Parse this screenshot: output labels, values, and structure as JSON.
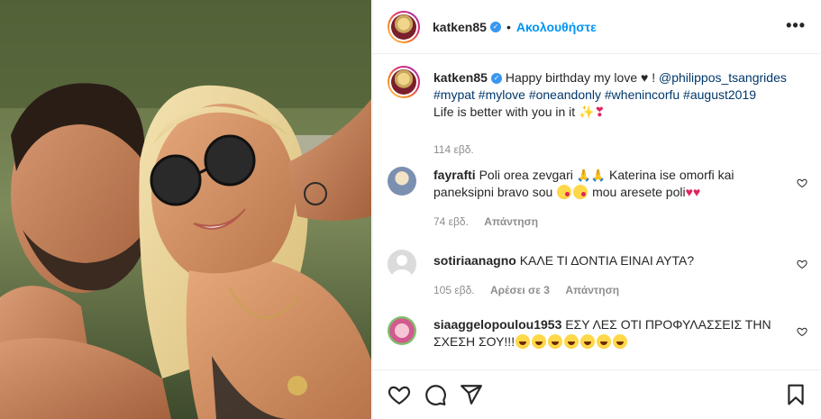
{
  "post": {
    "author": "katken85",
    "follow_label": "Ακολουθήστε",
    "separator": "•",
    "more_label": "•••",
    "caption": {
      "text": "Happy birthday my love ♥ ! ",
      "mention": "@philippos_tsangrides",
      "hashtags": "#mypat #mylove #oneandonly #whenincorfu #august2019",
      "line2": "Life is better with you in it",
      "line2_emoji": "✨❣",
      "age": "114 εβδ."
    }
  },
  "comments": [
    {
      "user": "fayrafti",
      "text_a": "Poli orea zevgari ",
      "emoji_a": "🙏🙏",
      "text_b": " Katerina ise omorfi kai paneksipni bravo sou ",
      "text_c": " mou aresete poli",
      "age": "74 εβδ.",
      "reply": "Απάντηση"
    },
    {
      "user": "sotiriaanagno",
      "text": "ΚΑΛΕ ΤΙ ΔΟΝΤΙΑ ΕΙΝΑΙ ΑΥΤΑ?",
      "age": "105 εβδ.",
      "likes": "Αρέσει σε 3",
      "reply": "Απάντηση"
    },
    {
      "user": "siaaggelopoulou1953",
      "text": "ΕΣΥ ΛΕΣ ΟΤΙ ΠΡΟΦΥΛΑΣΣΕΙΣ ΤΗΝ ΣΧΕΣΗ ΣΟΥ!!!"
    }
  ],
  "icons": {
    "verified": "✓",
    "like": "heart-icon",
    "comment": "comment-icon",
    "share": "share-icon",
    "save": "bookmark-icon"
  },
  "colors": {
    "link": "#00376b",
    "follow": "#0095f6",
    "verified": "#3897f0",
    "muted": "#8e8e8e"
  }
}
